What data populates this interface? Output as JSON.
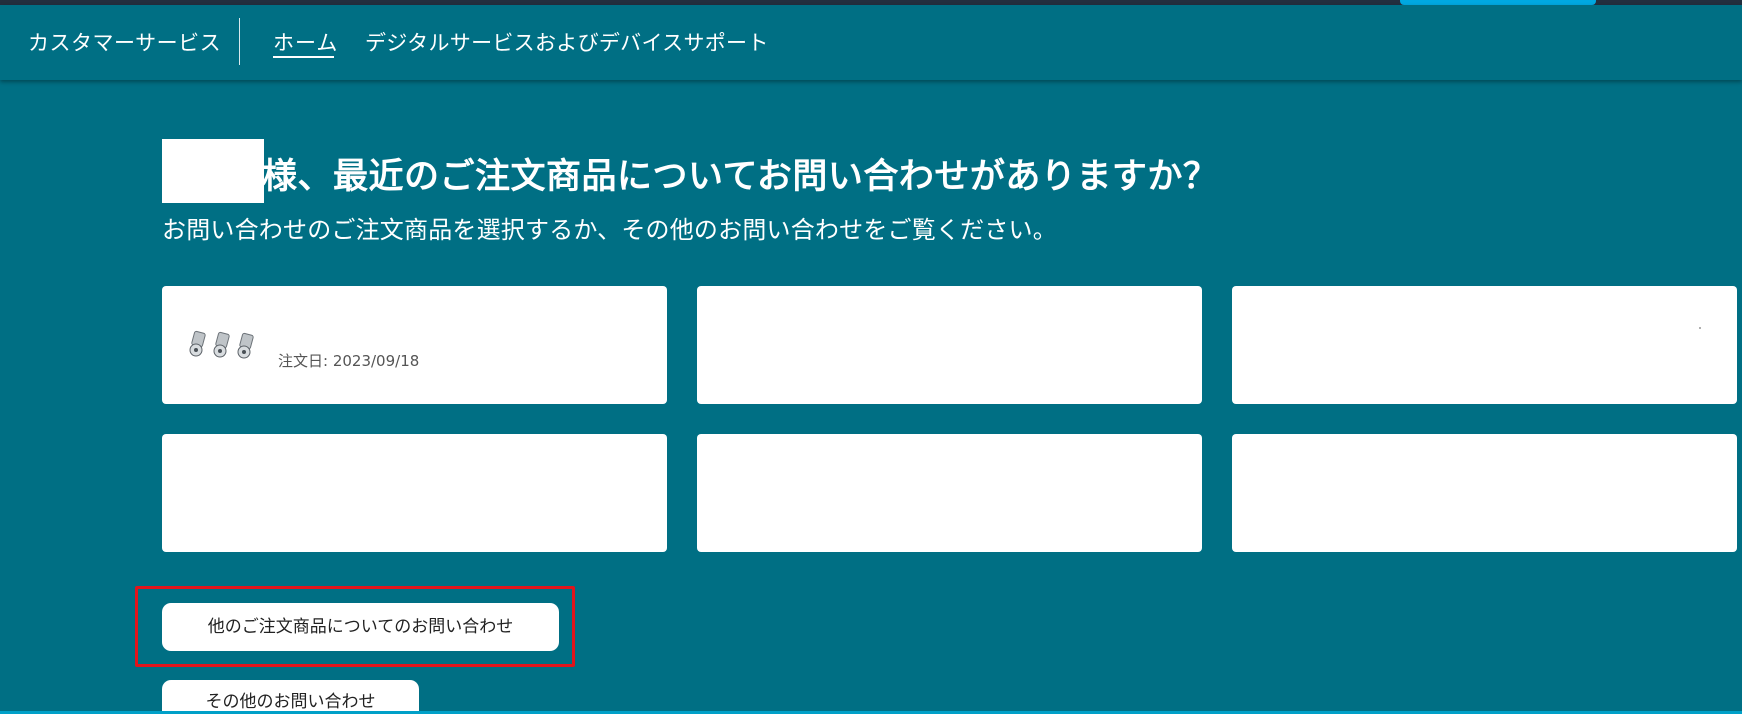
{
  "nav": {
    "brand": "カスタマーサービス",
    "home": "ホーム",
    "digital_support": "デジタルサービスおよびデバイスサポート"
  },
  "hero": {
    "greeting": "様、最近のご注文商品についてお問い合わせがありますか？",
    "subtitle": "お問い合わせのご注文商品を選択するか、その他のお問い合わせをご覧ください。"
  },
  "orders": [
    {
      "order_date": "注文日: 2023/09/18",
      "thumbnail_icon": "hose-fittings-thumbnail"
    },
    {
      "order_date": ""
    },
    {
      "order_date": ""
    },
    {
      "order_date": ""
    },
    {
      "order_date": ""
    },
    {
      "order_date": ""
    }
  ],
  "buttons": {
    "other_order": "他のご注文商品についてのお問い合わせ",
    "other_inquiry": "その他のお問い合わせ"
  },
  "colors": {
    "background": "#006f84",
    "top_bar": "#232f3e",
    "accent": "#00a8e1",
    "highlight_box": "#e2141b",
    "card": "#ffffff"
  }
}
